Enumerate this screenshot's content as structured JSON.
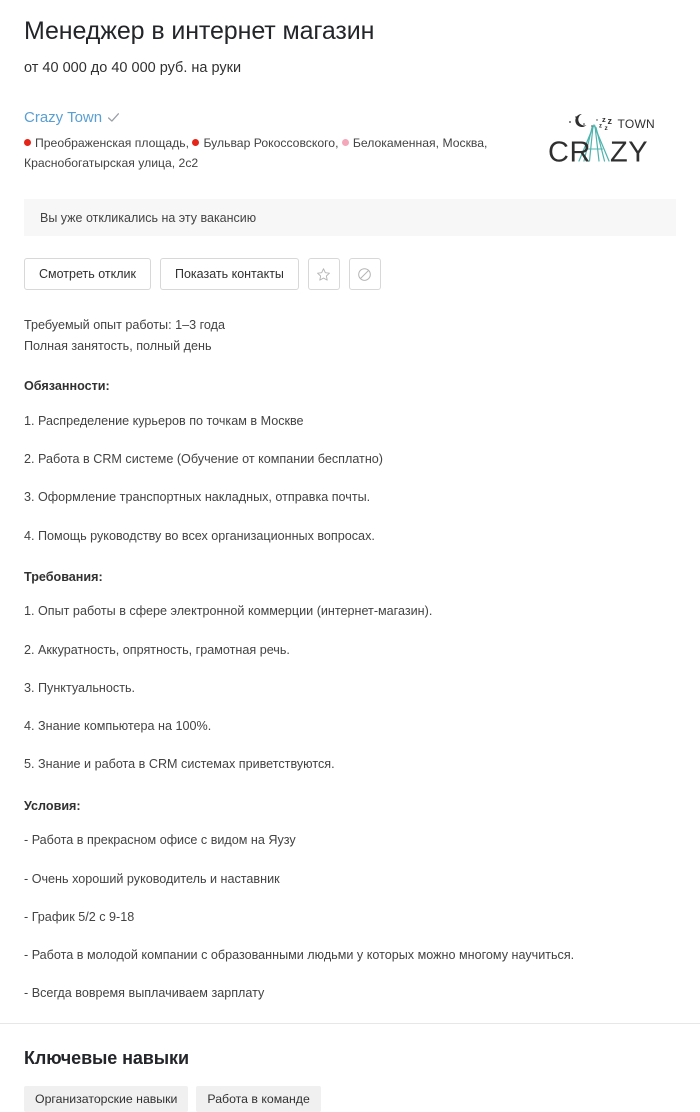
{
  "vacancy": {
    "title": "Менеджер в интернет магазин",
    "salary": "от 40 000 до 40 000 руб. на руки"
  },
  "company": {
    "name": "Crazy Town",
    "verified_icon": "check-icon",
    "logo": {
      "icon_name": "crazy-town-logo",
      "word_crazy": "CRAZY",
      "word_town": "TOWN",
      "sleep_mark": "Zz",
      "tent_color": "#4fb3ad",
      "text_color": "#2f2f2f"
    },
    "address": {
      "metro_stations": [
        {
          "name": "Преображенская площадь",
          "color": "#e42518",
          "separator": ","
        },
        {
          "name": "Бульвар Рокоссовского",
          "color": "#e42518",
          "separator": ","
        },
        {
          "name": "Белокаменная",
          "color": "#f4a7b9",
          "separator": ","
        }
      ],
      "city": "Москва,",
      "street": "Краснобогатырская улица, 2с2"
    }
  },
  "banner": {
    "text": "Вы уже откликались на эту вакансию"
  },
  "actions": {
    "view_response_label": "Смотреть отклик",
    "show_contacts_label": "Показать контакты",
    "favorite_icon": "star-icon",
    "block_icon": "block-icon"
  },
  "meta": {
    "experience": "Требуемый опыт работы: 1–3 года",
    "employment": "Полная занятость, полный день"
  },
  "description": {
    "sections": [
      {
        "heading": "Обязанности:",
        "items": [
          "1. Распределение курьеров по точкам в Москве",
          "2. Работа в CRM системе (Обучение от компании бесплатно)",
          "3. Оформление транспортных накладных, отправка почты.",
          "4. Помощь руководству во всех организационных вопросах."
        ]
      },
      {
        "heading": "Требования:",
        "items": [
          "1. Опыт работы в сфере электронной коммерции (интернет-магазин).",
          "2. Аккуратность, опрятность, грамотная речь.",
          "3. Пунктуальность.",
          "4. Знание компьютера на 100%.",
          "5. Знание и работа в CRM системах приветствуются."
        ]
      },
      {
        "heading": "Условия:",
        "items": [
          "- Работа в прекрасном офисе с видом на Яузу",
          "- Очень хороший руководитель и наставник",
          "- График 5/2 с 9-18",
          "- Работа в молодой компании с образованными людьми у которых можно многому научиться.",
          "- Всегда вовремя выплачиваем зарплату"
        ]
      }
    ]
  },
  "skills": {
    "title": "Ключевые навыки",
    "tags": [
      "Организаторские навыки",
      "Работа в команде"
    ]
  },
  "colors": {
    "link": "#5a9fd4",
    "metro_red": "#e42518",
    "metro_pink": "#f4a7b9",
    "banner_bg": "#f7f7f7",
    "tag_bg": "#f0f0f0",
    "border": "#d8d8d8"
  }
}
